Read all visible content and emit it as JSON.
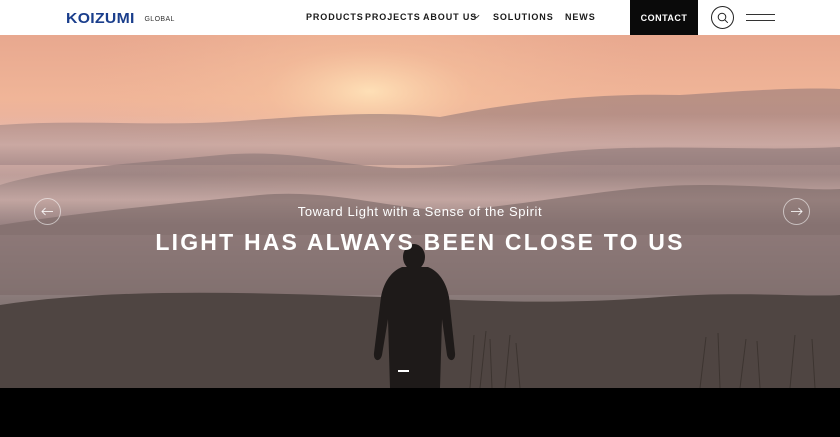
{
  "brand": {
    "logo_text": "KOIZUMI",
    "logo_sub": "GLOBAL",
    "logo_color": "#1a3e8c"
  },
  "nav": {
    "items": [
      "PRODUCTS",
      "PROJECTS",
      "ABOUT US",
      "SOLUTIONS",
      "NEWS"
    ],
    "contact": "CONTACT"
  },
  "hero": {
    "subtitle": "Toward Light with a Sense of the Spirit",
    "title": "LIGHT HAS ALWAYS BEEN CLOSE TO US"
  },
  "icons": {
    "search": "search-icon",
    "menu": "hamburger-menu-icon",
    "prev": "arrow-left-icon",
    "next": "arrow-right-icon",
    "dropdown": "chevron-down-icon"
  }
}
